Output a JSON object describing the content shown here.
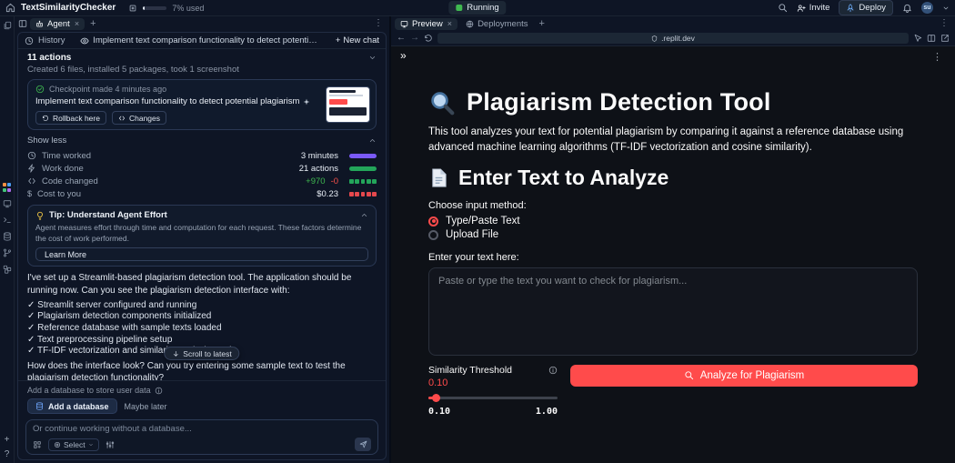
{
  "icons": {
    "close": "×",
    "plus": "+",
    "kebab": "⋮",
    "back": "←",
    "forward": "→",
    "collapse": "»",
    "dollar": "$",
    "help": "?"
  },
  "topbar": {
    "app_name": "TextSimilarityChecker",
    "usage_fill": "7%",
    "usage_label": "7% used",
    "status_label": "Running",
    "status_color": "#3fb950",
    "invite_label": "Invite",
    "deploy_label": "Deploy",
    "avatar_initials": "su"
  },
  "agent_panel": {
    "tab_label": "Agent",
    "header": {
      "history_label": "History",
      "session_title": "Implement text comparison functionality to detect potential plagiarism",
      "new_chat_label": "New chat"
    },
    "summary": {
      "actions": "11 actions",
      "detail": "Created 6 files, installed 5 packages, took 1 screenshot"
    },
    "checkpoint": {
      "meta": "Checkpoint made 4 minutes ago",
      "title": "Implement text comparison functionality to detect potential plagiarism",
      "rollback_label": "Rollback here",
      "changes_label": "Changes"
    },
    "show_less_label": "Show less",
    "metrics": [
      {
        "label": "Time worked",
        "value": "3 minutes",
        "bar_color": "#7a5af8"
      },
      {
        "label": "Work done",
        "value": "21 actions",
        "bar_color": "#23a55a"
      },
      {
        "label": "Code changed",
        "added": "+970",
        "removed": "-0",
        "bar_color": "#23a55a"
      },
      {
        "label": "Cost to you",
        "value": "$0.23",
        "bar_color": "#e5484d"
      }
    ],
    "diff_add_color": "#3fb950",
    "diff_del_color": "#f85149",
    "tip": {
      "title": "Tip: Understand Agent Effort",
      "body": "Agent measures effort through time and computation for each request. These factors determine the cost of work performed.",
      "button_label": "Learn More"
    },
    "message": {
      "intro": "I've set up a Streamlit-based plagiarism detection tool. The application should be running now. Can you see the plagiarism detection interface with:",
      "checklist": [
        "✓ Streamlit server configured and running",
        "✓ Plagiarism detection components initialized",
        "✓ Reference database with sample texts loaded",
        "✓ Text preprocessing pipeline setup",
        "✓ TF-IDF vectorization and similarity analysis ready"
      ],
      "question": "How does the interface look? Can you try entering some sample text to test the plagiarism detection functionality?"
    },
    "scroll_to_latest_label": "Scroll to latest",
    "database_prompt": {
      "text": "Add a database to store user data",
      "add_label": "Add a database",
      "later_label": "Maybe later"
    },
    "composer": {
      "placeholder": "Or continue working without a database...",
      "select_label": "Select"
    }
  },
  "preview_panel": {
    "tabs": [
      {
        "label": "Preview"
      },
      {
        "label": "Deployments"
      }
    ],
    "url": ".replit.dev",
    "app": {
      "title": "Plagiarism Detection Tool",
      "description": "This tool analyzes your text for potential plagiarism by comparing it against a reference database using advanced machine learning algorithms (TF-IDF vectorization and cosine similarity).",
      "section_heading": "Enter Text to Analyze",
      "input_method_label": "Choose input method:",
      "radios": [
        {
          "label": "Type/Paste Text",
          "selected": true
        },
        {
          "label": "Upload File",
          "selected": false
        }
      ],
      "text_input_label": "Enter your text here:",
      "textarea_placeholder": "Paste or type the text you want to check for plagiarism...",
      "slider": {
        "label": "Similarity Threshold",
        "value": "0.10",
        "min": "0.10",
        "max": "1.00"
      },
      "analyze_button_label": "Analyze for Plagiarism",
      "accent_color": "#ff4b4b"
    }
  }
}
